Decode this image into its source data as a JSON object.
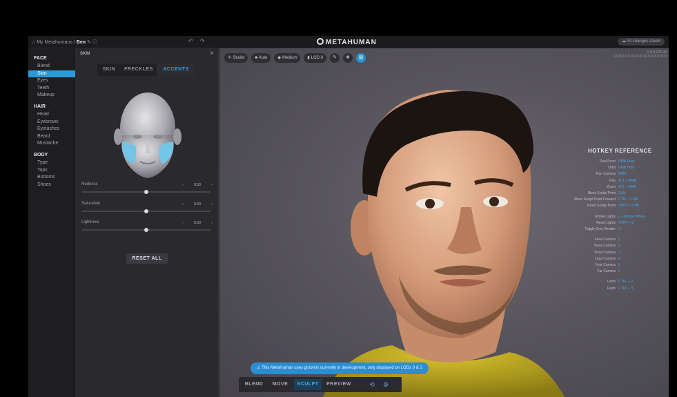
{
  "topbar": {
    "crumb_prefix": "My Metahumans /",
    "crumb_name": "Ben",
    "undo_redo": "↶ ↷",
    "brand": "METAHUMAN",
    "saved_status": "All changes saved"
  },
  "nav": {
    "sections": [
      {
        "title": "FACE",
        "items": [
          "Blend",
          "Skin",
          "Eyes",
          "Teeth",
          "Makeup"
        ]
      },
      {
        "title": "HAIR",
        "items": [
          "Head",
          "Eyebrows",
          "Eyelashes",
          "Beard",
          "Mustache"
        ]
      },
      {
        "title": "BODY",
        "items": [
          "Type",
          "Tops",
          "Bottoms",
          "Shoes"
        ]
      }
    ],
    "active_item": "Skin"
  },
  "panel": {
    "title": "SKIN",
    "tabs": [
      "SKIN",
      "FRECKLES",
      "ACCENTS"
    ],
    "active_tab": "ACCENTS",
    "sliders": [
      {
        "label": "Redness",
        "value": "0.50",
        "level": 0.5
      },
      {
        "label": "Saturation",
        "value": "0.50",
        "level": 0.5
      },
      {
        "label": "Lightness",
        "value": "0.50",
        "level": 0.5
      }
    ],
    "reset_label": "RESET ALL",
    "accent_color": "#74c4e6"
  },
  "viewport": {
    "toolbar": [
      {
        "icon": "lighting-icon",
        "glyph": "☀",
        "label": "Studio"
      },
      {
        "icon": "camera-icon",
        "glyph": "■",
        "label": "Auto"
      },
      {
        "icon": "quality-icon",
        "glyph": "◆",
        "label": "Medium"
      },
      {
        "icon": "lod-icon",
        "glyph": "▮",
        "label": "LOD 0"
      },
      {
        "icon": "brush-icon",
        "glyph": "✎",
        "label": ""
      },
      {
        "icon": "dna-icon",
        "glyph": "❖",
        "label": ""
      },
      {
        "icon": "compare-icon",
        "glyph": "▥",
        "label": ""
      }
    ],
    "perf_lines": [
      "0 0 0 FPS 60",
      "0.0 0 0 0 0 0 0 0 0 0 0 0 0 0 0 0 0 0"
    ],
    "hotkeys_title": "HOTKEY REFERENCE",
    "hotkeys": [
      {
        "k": "Pan/Zoom",
        "v": "RMB Drag"
      },
      {
        "k": "Orbit",
        "v": "RMB Hold"
      },
      {
        "k": "Pan Camera",
        "v": "MMB"
      },
      {
        "k": "Pan",
        "v": "ALT + MMB"
      },
      {
        "k": "Zoom",
        "v": "ALT + RMB"
      },
      {
        "k": "Move Sculpt Point",
        "v": "LMB"
      },
      {
        "k": "Move Sculpt Point Forward",
        "v": "CTRL + LMB"
      },
      {
        "k": "Reset Sculpt Point",
        "v": "SHIFT + LMB"
      },
      {
        "k": "Rotate Lights",
        "v": "L + Mouse Wheel"
      },
      {
        "k": "Reset Lights",
        "v": "SHIFT + L"
      },
      {
        "k": "Toggle Grey Render",
        "v": "G"
      },
      {
        "k": "Face Camera",
        "v": "1"
      },
      {
        "k": "Body Camera",
        "v": "2"
      },
      {
        "k": "Torso Camera",
        "v": "3"
      },
      {
        "k": "Legs Camera",
        "v": "4"
      },
      {
        "k": "Feet Camera",
        "v": "5"
      },
      {
        "k": "Far Camera",
        "v": "6"
      },
      {
        "k": "Undo",
        "v": "CTRL + Z"
      },
      {
        "k": "Redo",
        "v": "CTRL + Y"
      }
    ],
    "banner": "This MetaHuman uses groom/s currently in development, only displayed on LODs 0 & 1",
    "modes": [
      "BLEND",
      "MOVE",
      "SCULPT",
      "PREVIEW"
    ],
    "active_mode": "SCULPT"
  }
}
